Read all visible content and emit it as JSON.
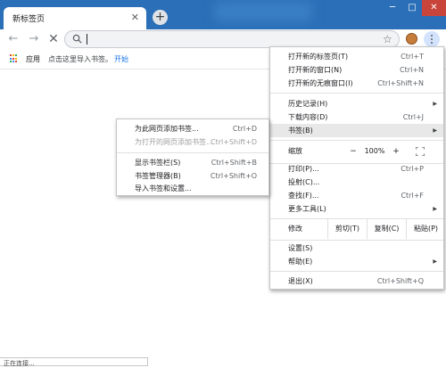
{
  "tab": {
    "title": "新标签页",
    "close_icon": "close-icon"
  },
  "window_controls": {
    "minimize": "─",
    "maximize": "□",
    "close": "✕"
  },
  "colors": {
    "titlebar": "#2a6fb7",
    "link": "#1a73e8",
    "close_button": "#c9453b"
  },
  "toolbar": {
    "back": "←",
    "forward": "→",
    "stop": "✕",
    "omnibox_value": "",
    "star": "☆"
  },
  "bookmarks_bar": {
    "apps_label": "应用",
    "hint": "点击这里导入书签。",
    "start_link": "开始"
  },
  "status_bar": {
    "text": "正在连接..."
  },
  "main_menu": {
    "items_top": [
      {
        "label": "打开新的标签页(T)",
        "shortcut": "Ctrl+T"
      },
      {
        "label": "打开新的窗口(N)",
        "shortcut": "Ctrl+N"
      },
      {
        "label": "打开新的无痕窗口(I)",
        "shortcut": "Ctrl+Shift+N"
      }
    ],
    "items_mid": [
      {
        "label": "历史记录(H)",
        "shortcut": "",
        "arrow": "▶"
      },
      {
        "label": "下载内容(D)",
        "shortcut": "Ctrl+J"
      },
      {
        "label": "书签(B)",
        "shortcut": "",
        "arrow": "▶"
      }
    ],
    "zoom": {
      "label": "缩放",
      "minus": "−",
      "value": "100%",
      "plus": "+"
    },
    "items_tools": [
      {
        "label": "打印(P)...",
        "shortcut": "Ctrl+P"
      },
      {
        "label": "投射(C)...",
        "shortcut": ""
      },
      {
        "label": "查找(F)...",
        "shortcut": "Ctrl+F"
      },
      {
        "label": "更多工具(L)",
        "shortcut": "",
        "arrow": "▶"
      }
    ],
    "edit": {
      "label": "修改",
      "cut": "剪切(T)",
      "copy": "复制(C)",
      "paste": "粘贴(P)"
    },
    "items_settings": [
      {
        "label": "设置(S)",
        "shortcut": ""
      },
      {
        "label": "帮助(E)",
        "shortcut": "",
        "arrow": "▶"
      }
    ],
    "exit": {
      "label": "退出(X)",
      "shortcut": "Ctrl+Shift+Q"
    }
  },
  "bookmarks_submenu": {
    "items": [
      {
        "label": "为此网页添加书签...",
        "shortcut": "Ctrl+D"
      },
      {
        "label": "为打开的网页添加书签...",
        "shortcut": "Ctrl+Shift+D"
      }
    ],
    "items2": [
      {
        "label": "显示书签栏(S)",
        "shortcut": "Ctrl+Shift+B"
      },
      {
        "label": "书签管理器(B)",
        "shortcut": "Ctrl+Shift+O"
      },
      {
        "label": "导入书签和设置...",
        "shortcut": ""
      }
    ]
  }
}
